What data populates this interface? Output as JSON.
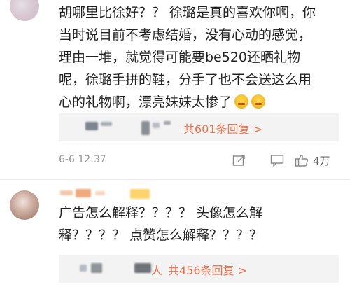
{
  "comments": [
    {
      "lines": [
        "胡哪里比徐好？？ 徐璐是真的喜欢你啊，你",
        "当时说目前不考虑结婚，没有心动的感觉，",
        "理由一堆，就觉得可能要be520还晒礼物",
        "呢，徐璐手拼的鞋，分手了也不会送这么用",
        "心的礼物啊，漂亮妹妹太惨了"
      ],
      "reply_summary": {
        "suffix": "共601条回复 >"
      },
      "time": "6-6 12:37",
      "like_count": "4万"
    },
    {
      "lines": [
        "广告怎么解释？？？？ 头像怎么解",
        "释？？？？ 点赞怎么解释？？？？"
      ],
      "reply_summary": {
        "prefix_char": "人",
        "suffix": "共456条回复 >"
      }
    }
  ],
  "icons": {
    "share": "share-icon",
    "comment": "comment-icon",
    "like": "thumbs-up-icon",
    "emoji": "crying-face-emoji-icon"
  },
  "colors": {
    "accent": "#eb7350",
    "meta": "#999999",
    "reply_bg": "#f3f3f3"
  }
}
